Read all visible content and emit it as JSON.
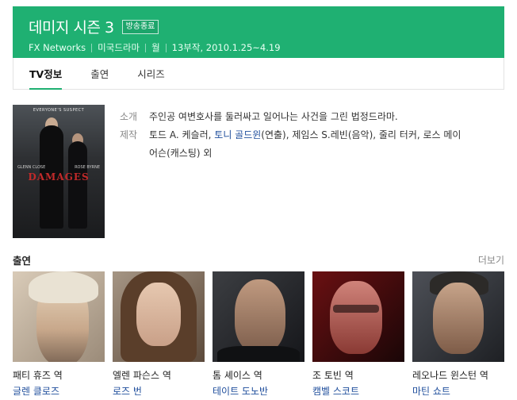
{
  "header": {
    "title": "데미지 시즌 3",
    "badge": "방송종료",
    "network": "FX Networks",
    "genre": "미국드라마",
    "day": "월",
    "episodes": "13부작, 2010.1.25~4.19"
  },
  "tabs": [
    {
      "label": "TV정보",
      "active": true
    },
    {
      "label": "출연",
      "active": false
    },
    {
      "label": "시리즈",
      "active": false
    }
  ],
  "poster": {
    "tagline": "EVERYONE'S SUSPECT",
    "actor_left": "GLENN CLOSE",
    "actor_right": "ROSE BYRNE",
    "logo": "DAMAGES"
  },
  "info": {
    "summary_label": "소개",
    "summary": "주인공 여변호사를 둘러싸고 일어나는 사건을 그린 법정드라마.",
    "production_label": "제작",
    "production_line1_a": "토드 A. 케슬러, ",
    "production_link": "토니 골드윈",
    "production_line1_b": "(연출), 제임스 S.레빈(음악), 줄리 터커, 로스 메이",
    "production_line2": "어슨(캐스팅) 외"
  },
  "cast_section": {
    "title": "출연",
    "more": "더보기"
  },
  "cast": [
    {
      "role": "패티 휴즈 역",
      "actor": "글렌 클로즈"
    },
    {
      "role": "엘렌 파슨스 역",
      "actor": "로즈 번"
    },
    {
      "role": "톰 셰이스 역",
      "actor": "테이트 도노반"
    },
    {
      "role": "조 토빈 역",
      "actor": "캠벨 스코트"
    },
    {
      "role": "레오나드 윈스턴 역",
      "actor": "마틴 쇼트"
    }
  ],
  "colors": {
    "accent": "#1fb072",
    "link": "#1f4e9c"
  }
}
